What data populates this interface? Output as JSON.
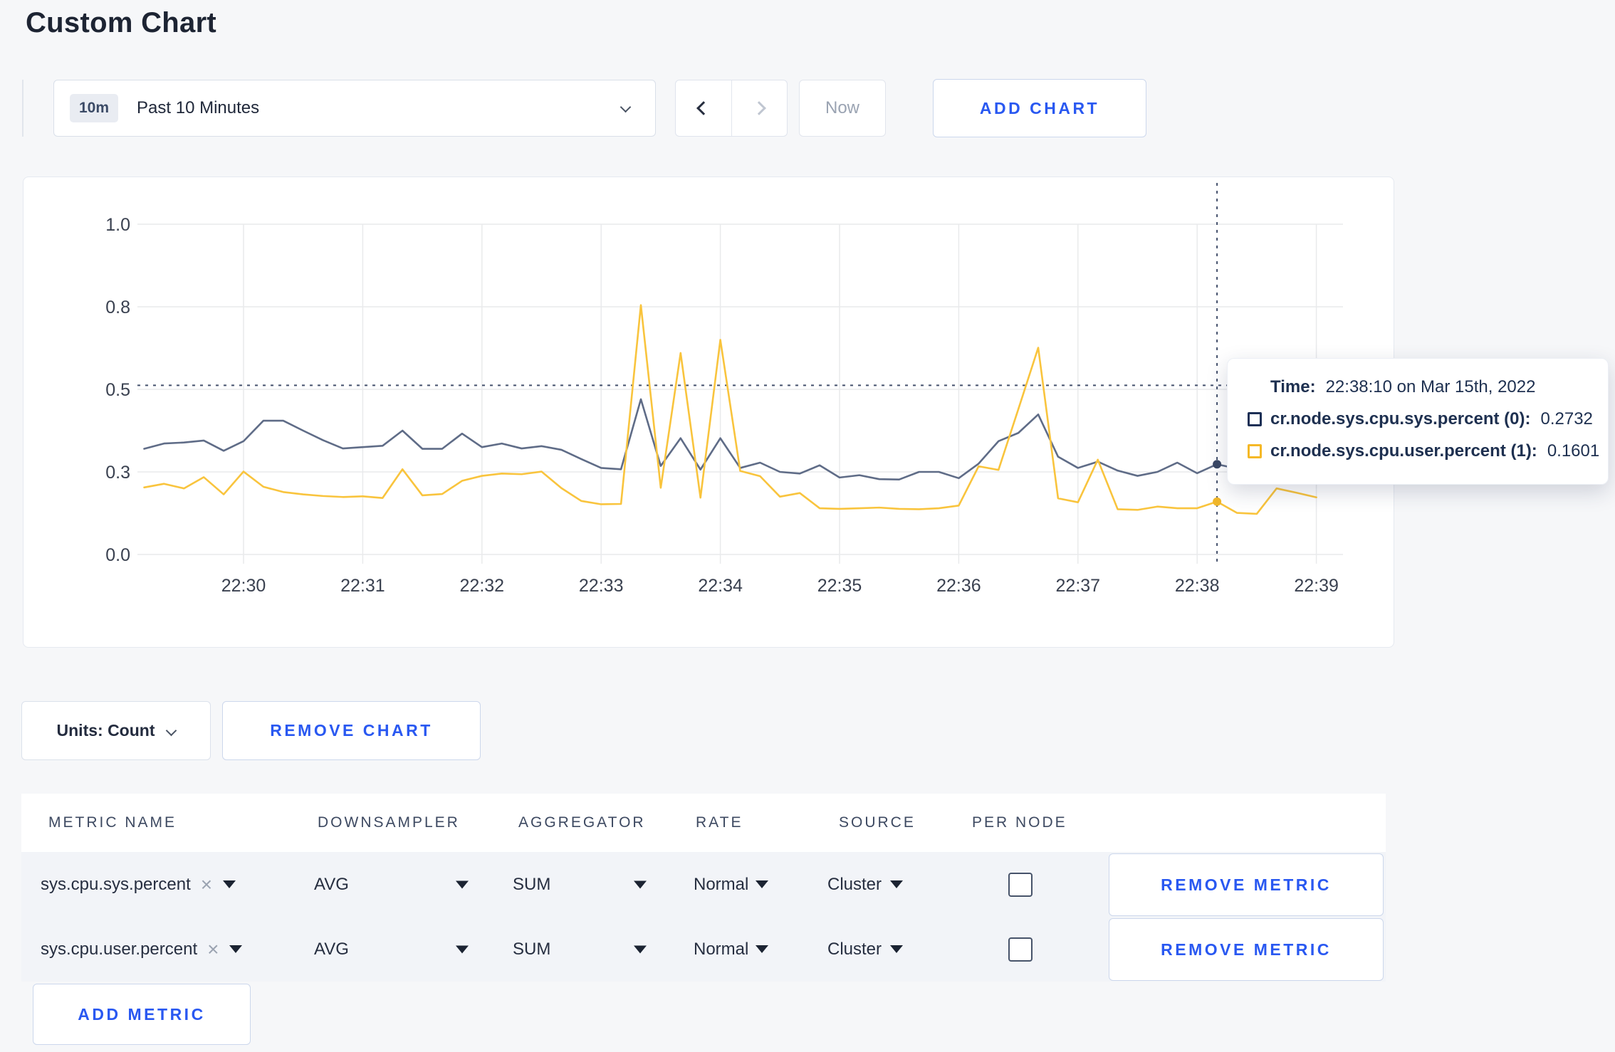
{
  "page": {
    "title": "Custom Chart"
  },
  "toolbar": {
    "time_badge": "10m",
    "time_label": "Past 10 Minutes",
    "now_label": "Now",
    "add_chart_label": "ADD CHART"
  },
  "chart_data": {
    "type": "line",
    "title": "",
    "xlabel": "",
    "ylabel": "",
    "grid": true,
    "legend_position": "none",
    "ylim": [
      0,
      1
    ],
    "start_time": "22:29:10",
    "point_interval_sec": 10,
    "x_ticks": [
      {
        "t": 50,
        "label": "22:30"
      },
      {
        "t": 110,
        "label": "22:31"
      },
      {
        "t": 170,
        "label": "22:32"
      },
      {
        "t": 230,
        "label": "22:33"
      },
      {
        "t": 290,
        "label": "22:34"
      },
      {
        "t": 350,
        "label": "22:35"
      },
      {
        "t": 410,
        "label": "22:36"
      },
      {
        "t": 470,
        "label": "22:37"
      },
      {
        "t": 530,
        "label": "22:38"
      },
      {
        "t": 590,
        "label": "22:39"
      }
    ],
    "y_ticks": [
      {
        "v": 0,
        "label": "0.0"
      },
      {
        "v": 0.25,
        "label": "0.3"
      },
      {
        "v": 0.5,
        "label": "0.5"
      },
      {
        "v": 0.75,
        "label": "0.8"
      },
      {
        "v": 1,
        "label": "1.0"
      }
    ],
    "series": [
      {
        "name": "cr.node.sys.cpu.sys.percent",
        "color": "#5f6c87",
        "dot_color": "#3b4865",
        "values": [
          0.32,
          0.336,
          0.339,
          0.345,
          0.314,
          0.343,
          0.405,
          0.405,
          0.375,
          0.346,
          0.321,
          0.325,
          0.329,
          0.375,
          0.32,
          0.32,
          0.366,
          0.325,
          0.336,
          0.321,
          0.328,
          0.317,
          0.289,
          0.262,
          0.258,
          0.47,
          0.268,
          0.352,
          0.257,
          0.352,
          0.262,
          0.278,
          0.25,
          0.245,
          0.27,
          0.233,
          0.24,
          0.228,
          0.227,
          0.25,
          0.25,
          0.231,
          0.275,
          0.343,
          0.368,
          0.424,
          0.296,
          0.262,
          0.281,
          0.254,
          0.238,
          0.25,
          0.278,
          0.246,
          0.2732,
          0.26,
          0.255,
          0.27,
          0.26,
          0.27
        ]
      },
      {
        "name": "cr.node.sys.cpu.user.percent",
        "color": "#f9c43d",
        "dot_color": "#f0b62a",
        "values": [
          0.203,
          0.214,
          0.2,
          0.234,
          0.182,
          0.251,
          0.205,
          0.189,
          0.182,
          0.177,
          0.174,
          0.176,
          0.171,
          0.258,
          0.179,
          0.183,
          0.223,
          0.238,
          0.245,
          0.243,
          0.251,
          0.201,
          0.162,
          0.152,
          0.153,
          0.755,
          0.202,
          0.61,
          0.172,
          0.65,
          0.253,
          0.237,
          0.175,
          0.186,
          0.14,
          0.138,
          0.14,
          0.142,
          0.138,
          0.137,
          0.14,
          0.148,
          0.267,
          0.256,
          0.44,
          0.626,
          0.17,
          0.158,
          0.287,
          0.137,
          0.135,
          0.145,
          0.14,
          0.14,
          0.1601,
          0.126,
          0.123,
          0.2,
          0.187,
          0.173
        ]
      }
    ],
    "crosshair": {
      "t": 540,
      "time": "22:38:10",
      "hover_value": 0.512,
      "values": [
        0.2732,
        0.1601
      ]
    }
  },
  "tooltip": {
    "time_label": "Time:",
    "time_value": "22:38:10 on Mar 15th, 2022",
    "rows": [
      {
        "label": "cr.node.sys.cpu.sys.percent (0):",
        "value": "0.2732",
        "color": "#1c2f55"
      },
      {
        "label": "cr.node.sys.cpu.user.percent (1):",
        "value": "0.1601",
        "color": "#f5b826"
      }
    ]
  },
  "units_row": {
    "units_label": "Units: Count",
    "remove_chart_label": "REMOVE CHART"
  },
  "metrics_table": {
    "headers": [
      "METRIC NAME",
      "DOWNSAMPLER",
      "AGGREGATOR",
      "RATE",
      "SOURCE",
      "PER NODE"
    ],
    "rows": [
      {
        "metric": "sys.cpu.sys.percent",
        "remove_tag": "×",
        "downsampler": "AVG",
        "aggregator": "SUM",
        "rate": "Normal",
        "source": "Cluster",
        "per_node_checked": false,
        "remove_label": "REMOVE METRIC"
      },
      {
        "metric": "sys.cpu.user.percent",
        "remove_tag": "×",
        "downsampler": "AVG",
        "aggregator": "SUM",
        "rate": "Normal",
        "source": "Cluster",
        "per_node_checked": false,
        "remove_label": "REMOVE METRIC"
      }
    ],
    "add_metric_label": "ADD METRIC"
  }
}
